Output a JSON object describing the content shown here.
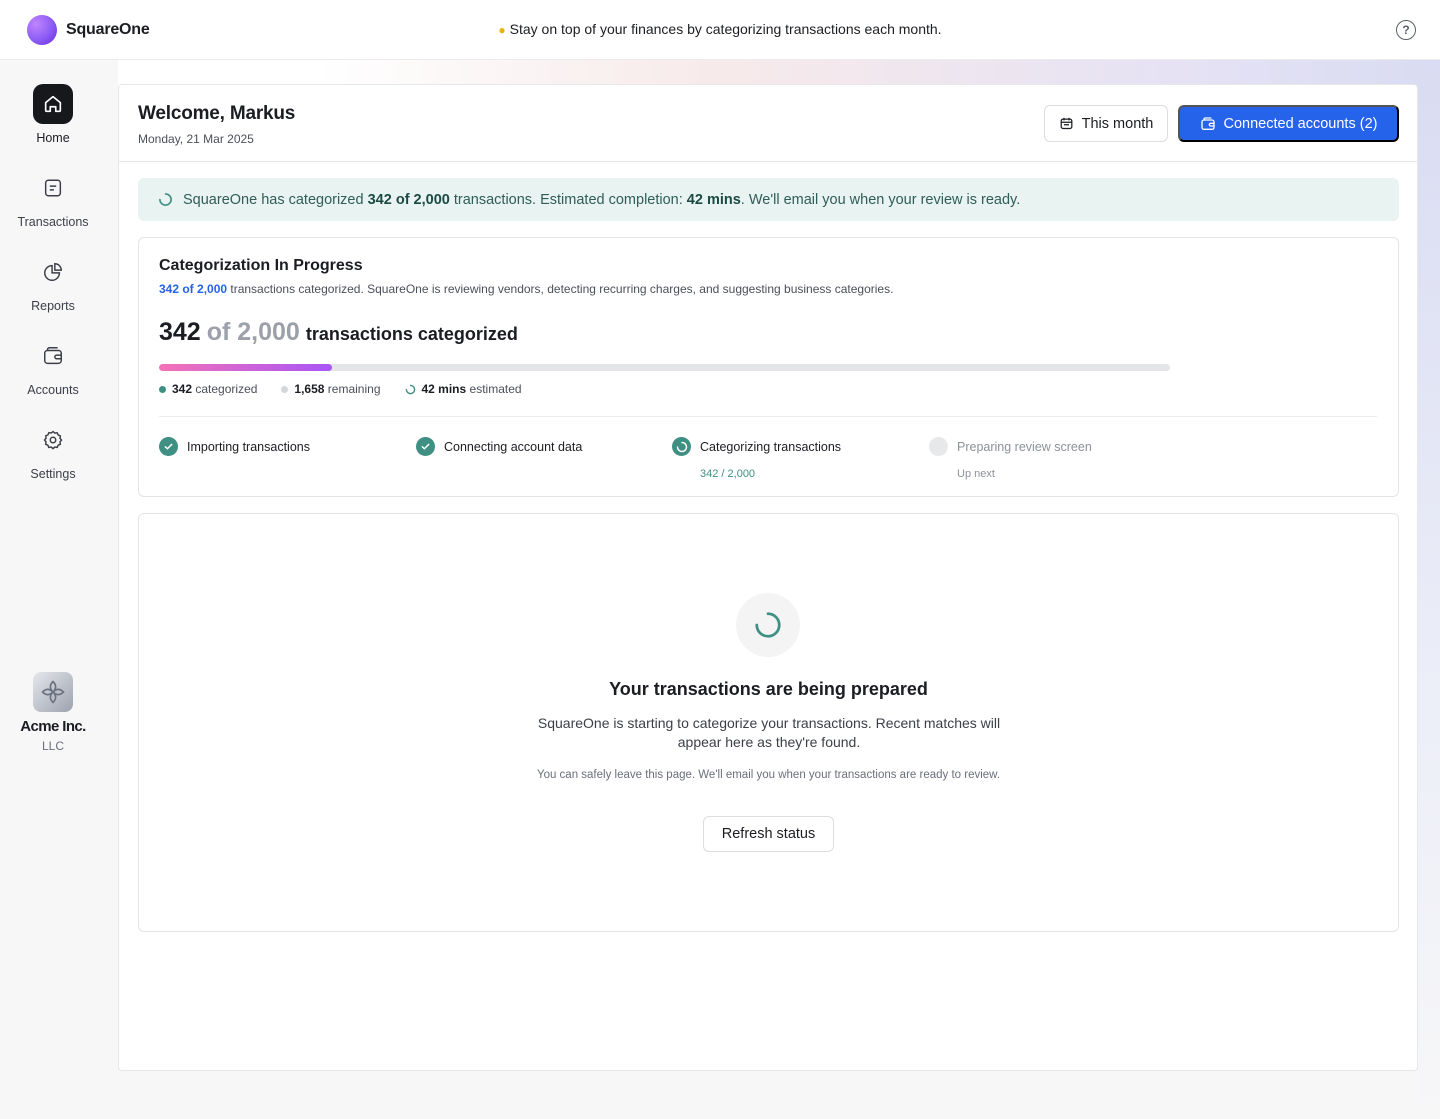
{
  "app": {
    "name": "SquareOne"
  },
  "topbar": {
    "tip_icon": "lightbulb-icon",
    "tip_text": "Stay on top of your finances by categorizing transactions each month.",
    "help_icon": "help-circle-icon",
    "help_glyph": "?"
  },
  "sidebar": {
    "items": [
      {
        "label": "Home",
        "icon": "home-icon",
        "active": true
      },
      {
        "label": "Transactions",
        "icon": "document-list-icon",
        "active": false
      },
      {
        "label": "Reports",
        "icon": "pie-chart-icon",
        "active": false
      },
      {
        "label": "Accounts",
        "icon": "wallet-icon",
        "active": false
      },
      {
        "label": "Settings",
        "icon": "gear-icon",
        "active": false
      }
    ],
    "org": {
      "name": "Acme Inc.",
      "type": "LLC"
    }
  },
  "header": {
    "welcome": "Welcome, Markus",
    "date": "Monday, 21 Mar 2025",
    "period_button": "This month",
    "accounts_button": "Connected accounts (2)"
  },
  "banner": {
    "prefix": "SquareOne has categorized",
    "count": "342 of 2,000",
    "middle": "transactions. Estimated completion:",
    "eta": "42 mins",
    "suffix": ". We'll email you when your review is ready."
  },
  "progress": {
    "title": "Categorization In Progress",
    "sub_highlight": "342 of 2,000",
    "sub_text": " transactions categorized. SquareOne is reviewing vendors, detecting recurring charges, and suggesting business categories.",
    "done": "342",
    "of_text": "of 2,000",
    "label": "transactions categorized",
    "fraction": 0.171,
    "stats": [
      {
        "value": "342",
        "label": "categorized",
        "color": "#3f8f83"
      },
      {
        "value": "1,658",
        "label": "remaining",
        "color": "#d4d6da"
      },
      {
        "value": "42 mins",
        "label": "estimated",
        "color": "#3f8f83"
      }
    ],
    "steps": [
      {
        "label": "Importing transactions",
        "status": "done",
        "sub": ""
      },
      {
        "label": "Connecting account data",
        "status": "done",
        "sub": ""
      },
      {
        "label": "Categorizing transactions",
        "status": "active",
        "sub": "342 / 2,000"
      },
      {
        "label": "Preparing review screen",
        "status": "pending",
        "sub": "Up next"
      }
    ]
  },
  "empty_state": {
    "title": "Your transactions are being prepared",
    "description": "SquareOne is starting to categorize your transactions. Recent matches will appear here as they're found.",
    "note": "You can safely leave this page. We'll email you when your transactions are ready to review.",
    "button": "Refresh status"
  },
  "colors": {
    "accent": "#2563eb",
    "teal": "#3f8f83",
    "banner_bg": "#e9f3f2"
  }
}
